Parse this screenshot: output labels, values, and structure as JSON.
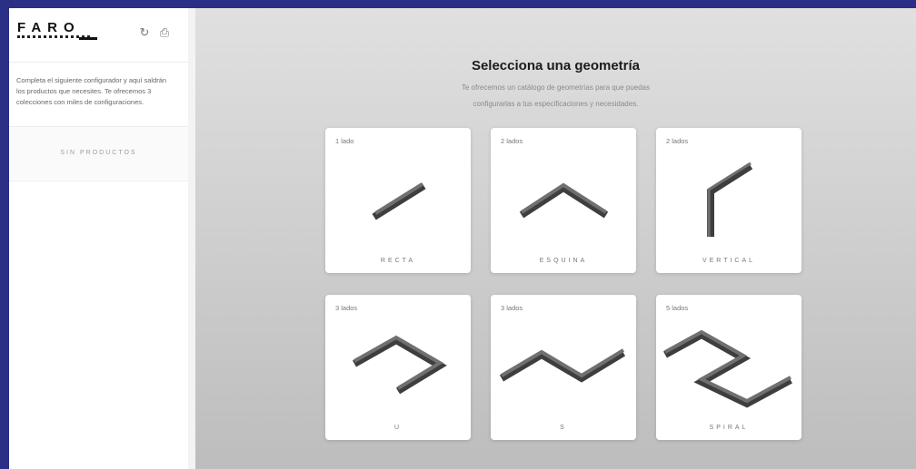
{
  "sidebar": {
    "logo_text": "FARO",
    "intro_text": "Completa el siguiente configurador y aquí saldrán los productos que necesites. Te ofrecemos 3 colecciones con miles de configuraciones.",
    "empty_label": "SIN PRODUCTOS",
    "reset_icon": "refresh-icon",
    "print_icon": "printer-icon"
  },
  "main": {
    "title": "Selecciona una geometría",
    "subtitle_line1": "Te ofrecemos un catálogo de geometrías para que puedas",
    "subtitle_line2": "configurarlas a tus especificaciones y necesidades."
  },
  "geometries": [
    {
      "sides": "1 lado",
      "label": "RECTA"
    },
    {
      "sides": "2 lados",
      "label": "ESQUINA"
    },
    {
      "sides": "2 lados",
      "label": "VERTICAL"
    },
    {
      "sides": "3 lados",
      "label": "U"
    },
    {
      "sides": "3 lados",
      "label": "S"
    },
    {
      "sides": "5 lados",
      "label": "SPIRAL"
    }
  ],
  "colors": {
    "frame": "#2b2f86",
    "shape_top": "#6f6f6f",
    "shape_side": "#3e3e3e"
  }
}
